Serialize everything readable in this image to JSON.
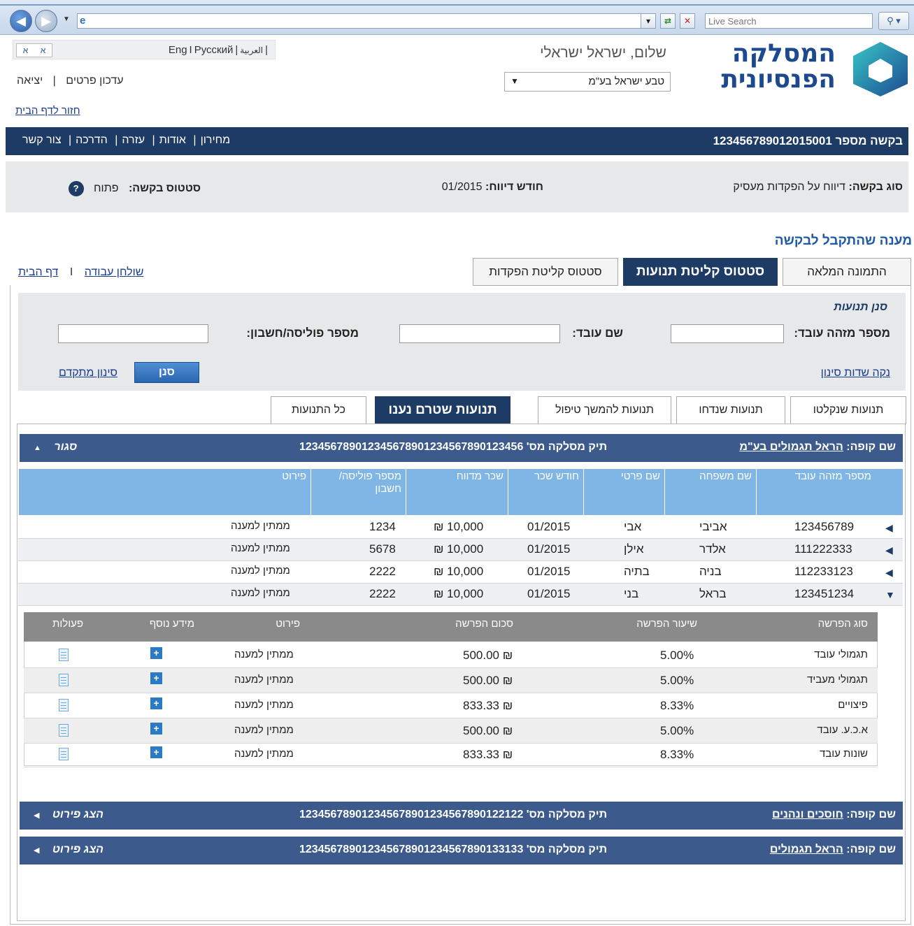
{
  "browser": {
    "search_placeholder": "Live Search"
  },
  "header": {
    "alef_a": "א",
    "alef_b": "א",
    "lang_arabic": "العربية",
    "lang_russian": "Русский",
    "lang_english": "Eng",
    "update_details": "עדכון פרטים",
    "logout": "יציאה",
    "home_link": "חזור לדף הבית",
    "greeting": "שלום, ישראל ישראלי",
    "employer": "טבע ישראל בע\"מ",
    "logo_line1": "המסלקה",
    "logo_line2": "הפנסיונית"
  },
  "navbar": {
    "request_number_label": "בקשה מספר",
    "request_number": "123456789012015001",
    "menu": [
      "מחירון",
      "אודות",
      "עזרה",
      "הדרכה",
      "צור קשר"
    ]
  },
  "summary": {
    "request_type_label": "סוג בקשה:",
    "request_type": "דיווח על הפקדות מעסיק",
    "report_month_label": "חודש דיווח:",
    "report_month": "01/2015",
    "status_label": "סטטוס בקשה:",
    "status": "פתוח",
    "help": "?"
  },
  "section_title": "מענה שהתקבל לבקשה",
  "top_links": {
    "work_table": "שולחן עבודה",
    "separator": "I",
    "home": "דף הבית"
  },
  "top_tabs": [
    "התמונה המלאה",
    "סטטוס קליטת תנועות",
    "סטטוס קליטת הפקדות"
  ],
  "filter": {
    "title": "סנן תנועות",
    "employee_id_label": "מספר מזהה עובד:",
    "employee_name_label": "שם עובד:",
    "policy_label": "מספר פוליסה/חשבון:",
    "clear": "נקה שדות סינון",
    "button": "סנן",
    "advanced": "סינון מתקדם"
  },
  "sub_tabs": [
    "תנועות שנקלטו",
    "תנועות שנדחו",
    "תנועות להמשך טיפול",
    "תנועות שטרם נענו",
    "כל התנועות"
  ],
  "funds": [
    {
      "label": "שם קופה:",
      "name": "הראל תגמולים בע\"מ",
      "tik_label": "תיק מסלקה מס'",
      "tik": "123456789012345678901234567890123456",
      "toggle": "סגור",
      "toggle_icon": "▲"
    },
    {
      "label": "שם קופה:",
      "name": "חוסכים ונהנים",
      "tik_label": "תיק מסלקה מס'",
      "tik": "123456789012345678901234567890122122",
      "toggle": "הצג פירוט",
      "toggle_icon": "◀"
    },
    {
      "label": "שם קופה:",
      "name": "הראל תגמולים",
      "tik_label": "תיק מסלקה מס'",
      "tik": "123456789012345678901234567890133133",
      "toggle": "הצג פירוט",
      "toggle_icon": "◀"
    }
  ],
  "main_table": {
    "headers": [
      "מספר מזהה עובד",
      "שם משפחה",
      "שם פרטי",
      "חודש שכר",
      "שכר מדווח",
      "מספר פוליסה/ חשבון",
      "פירוט"
    ],
    "rows": [
      {
        "id": "123456789",
        "last": "אביבי",
        "first": "אבי",
        "month": "01/2015",
        "salary": "10,000 ₪",
        "policy": "1234",
        "detail": "ממתין למענה",
        "toggle": "◀"
      },
      {
        "id": "111222333",
        "last": "אלדר",
        "first": "אילן",
        "month": "01/2015",
        "salary": "10,000 ₪",
        "policy": "5678",
        "detail": "ממתין למענה",
        "toggle": "◀"
      },
      {
        "id": "112233123",
        "last": "בניה",
        "first": "בתיה",
        "month": "01/2015",
        "salary": "10,000 ₪",
        "policy": "2222",
        "detail": "ממתין למענה",
        "toggle": "◀"
      },
      {
        "id": "123451234",
        "last": "בראל",
        "first": "בני",
        "month": "01/2015",
        "salary": "10,000 ₪",
        "policy": "2222",
        "detail": "ממתין למענה",
        "toggle": "▼"
      }
    ]
  },
  "sub_table": {
    "headers": [
      "סוג הפרשה",
      "שיעור הפרשה",
      "סכום הפרשה",
      "פירוט",
      "מידע נוסף",
      "פעולות"
    ],
    "rows": [
      {
        "type": "תגמולי עובד",
        "rate": "5.00%",
        "amount": "₪ 500.00",
        "detail": "ממתין למענה"
      },
      {
        "type": "תגמולי מעביד",
        "rate": "5.00%",
        "amount": "₪ 500.00",
        "detail": "ממתין למענה"
      },
      {
        "type": "פיצויים",
        "rate": "8.33%",
        "amount": "₪ 833.33",
        "detail": "ממתין למענה"
      },
      {
        "type": "א.כ.ע. עובד",
        "rate": "5.00%",
        "amount": "₪ 500.00",
        "detail": "ממתין למענה"
      },
      {
        "type": "שונות עובד",
        "rate": "8.33%",
        "amount": "₪ 833.33",
        "detail": "ממתין למענה"
      }
    ]
  },
  "colors": {
    "navy": "#1e3b66",
    "fund_bar": "#3c5b8c",
    "table_header": "#7fb6e5",
    "link": "#1b3f8c",
    "accent_title": "#1e5aa5"
  }
}
